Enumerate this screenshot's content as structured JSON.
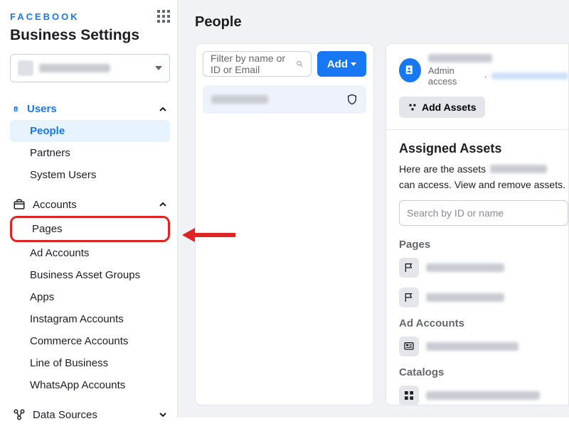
{
  "brand": "FACEBOOK",
  "settings_title": "Business Settings",
  "main_title": "People",
  "sidebar": {
    "users": {
      "label": "Users",
      "items": [
        {
          "label": "People"
        },
        {
          "label": "Partners"
        },
        {
          "label": "System Users"
        }
      ]
    },
    "accounts": {
      "label": "Accounts",
      "items": [
        {
          "label": "Pages"
        },
        {
          "label": "Ad Accounts"
        },
        {
          "label": "Business Asset Groups"
        },
        {
          "label": "Apps"
        },
        {
          "label": "Instagram Accounts"
        },
        {
          "label": "Commerce Accounts"
        },
        {
          "label": "Line of Business"
        },
        {
          "label": "WhatsApp Accounts"
        }
      ]
    },
    "data_sources": {
      "label": "Data Sources"
    }
  },
  "filter": {
    "placeholder": "Filter by name or ID or Email",
    "add": "Add"
  },
  "detail": {
    "access": "Admin access",
    "add_assets": "Add Assets",
    "assigned": "Assigned Assets",
    "desc_a": "Here are the assets",
    "desc_b": "can access. View and remove assets.",
    "search_placeholder": "Search by ID or name",
    "cat_pages": "Pages",
    "cat_ad": "Ad Accounts",
    "cat_catalogs": "Catalogs"
  }
}
